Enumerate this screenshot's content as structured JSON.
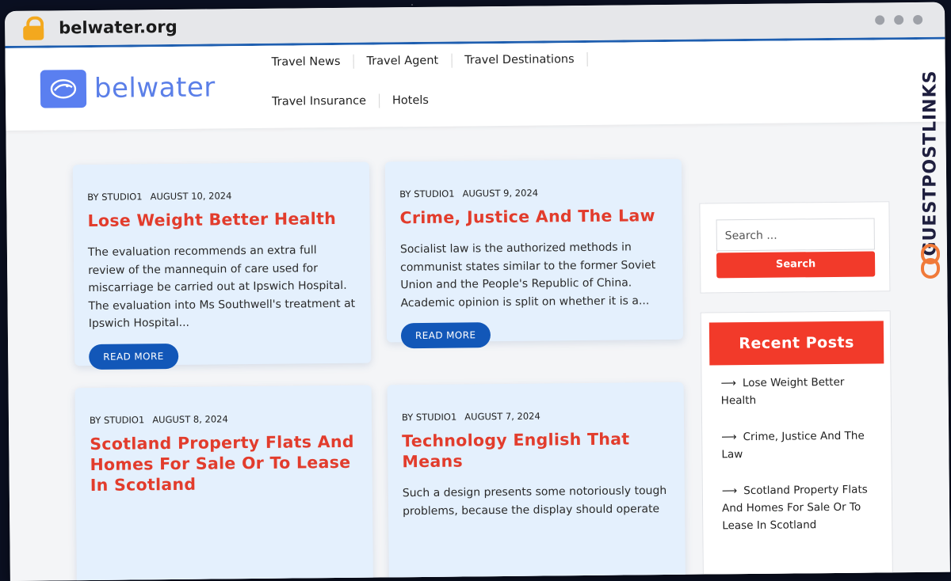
{
  "browser": {
    "url": "belwater.org"
  },
  "site": {
    "logo_text": "belwater",
    "nav_row1": [
      "Travel News",
      "Travel Agent",
      "Travel Destinations"
    ],
    "nav_row2": [
      "Travel Insurance",
      "Hotels"
    ]
  },
  "posts": [
    {
      "author": "BY STUDIO1",
      "date": "AUGUST 10, 2024",
      "title": "Lose Weight Better Health",
      "excerpt": "The evaluation recommends an extra full review of the mannequin of care used for miscarriage be carried out at Ipswich Hospital. The evaluation into Ms Southwell's treatment at Ipswich Hospital...",
      "read_more": "READ MORE"
    },
    {
      "author": "BY STUDIO1",
      "date": "AUGUST 9, 2024",
      "title": "Crime, Justice And The Law",
      "excerpt": "Socialist law is the authorized methods in communist states similar to the former Soviet Union and the People's Republic of China. Academic opinion is split on whether it is a...",
      "read_more": "READ MORE"
    },
    {
      "author": "BY STUDIO1",
      "date": "AUGUST 8, 2024",
      "title": "Scotland Property Flats And Homes For Sale Or To Lease In Scotland",
      "excerpt": "",
      "read_more": ""
    },
    {
      "author": "BY STUDIO1",
      "date": "AUGUST 7, 2024",
      "title": "Technology English That Means",
      "excerpt": "Such a design presents some notoriously tough problems, because the display should operate",
      "read_more": ""
    }
  ],
  "sidebar": {
    "search_placeholder": "Search ...",
    "search_button": "Search",
    "recent_title": "Recent Posts",
    "recent_items": [
      "Lose Weight Better Health",
      "Crime, Justice And The Law",
      "Scotland Property Flats And Homes For Sale Or To Lease In Scotland"
    ]
  },
  "watermark": {
    "text": "GUESTPOSTLINKS"
  },
  "colors": {
    "accent_red": "#e23c2c",
    "button_blue": "#1257b8",
    "logo_blue": "#5a7ff0",
    "card_bg": "#e4f0fd"
  }
}
